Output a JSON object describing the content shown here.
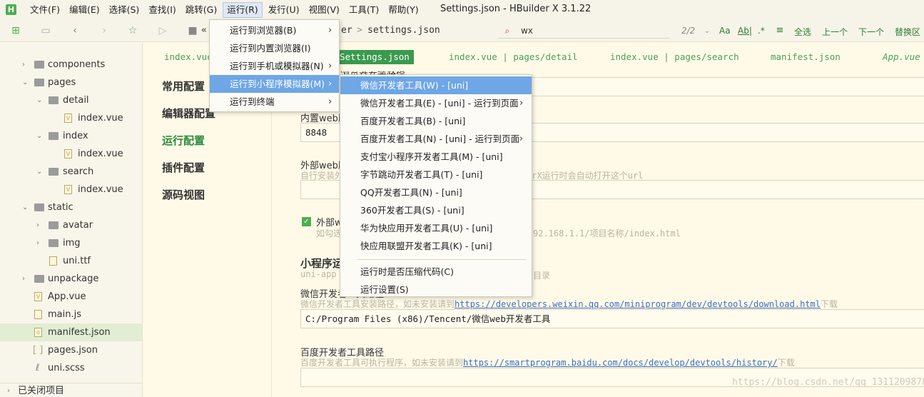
{
  "window": {
    "title": "Settings.json - HBuilder X 3.1.22",
    "logo": "H"
  },
  "menubar": [
    "文件(F)",
    "编辑(E)",
    "选择(S)",
    "查找(I)",
    "跳转(G)",
    "运行(R)",
    "发行(U)",
    "视图(V)",
    "工具(T)",
    "帮助(Y)"
  ],
  "toolbar": {
    "crumb_prefix": "«",
    "crumb_part": "er",
    "crumb_sep": ">",
    "crumb_file": "settings.json",
    "find_value": "wx",
    "find_count": "2/2",
    "find_options": [
      "Aa",
      "Ab|",
      ".*"
    ],
    "find_all": "全选",
    "find_prev": "上一个",
    "find_next": "下一个",
    "replace": "替换区"
  },
  "sidebar": {
    "items": [
      {
        "label": "components",
        "type": "folder",
        "depth": 0,
        "expanded": false
      },
      {
        "label": "pages",
        "type": "folder",
        "depth": 0,
        "expanded": true
      },
      {
        "label": "detail",
        "type": "folder",
        "depth": 1,
        "expanded": true
      },
      {
        "label": "index.vue",
        "type": "vue",
        "depth": 2
      },
      {
        "label": "index",
        "type": "folder",
        "depth": 1,
        "expanded": true
      },
      {
        "label": "index.vue",
        "type": "vue",
        "depth": 2
      },
      {
        "label": "search",
        "type": "folder",
        "depth": 1,
        "expanded": true
      },
      {
        "label": "index.vue",
        "type": "vue",
        "depth": 2
      },
      {
        "label": "static",
        "type": "folder",
        "depth": 0,
        "expanded": true
      },
      {
        "label": "avatar",
        "type": "folder",
        "depth": 1,
        "expanded": false
      },
      {
        "label": "img",
        "type": "folder",
        "depth": 1,
        "expanded": false
      },
      {
        "label": "uni.ttf",
        "type": "file",
        "depth": 1
      },
      {
        "label": "unpackage",
        "type": "folder",
        "depth": 0,
        "expanded": false
      },
      {
        "label": "App.vue",
        "type": "vue",
        "depth": 0
      },
      {
        "label": "main.js",
        "type": "file",
        "depth": 0
      },
      {
        "label": "manifest.json",
        "type": "json",
        "depth": 0,
        "selected": true
      },
      {
        "label": "pages.json",
        "type": "json",
        "depth": 0
      },
      {
        "label": "uni.scss",
        "type": "file",
        "depth": 0
      }
    ],
    "footer": "已关闭项目"
  },
  "tabs": [
    {
      "label": "index.vue"
    },
    {
      "label": "Settings.json",
      "active": true
    },
    {
      "label": "index.vue | pages/detail"
    },
    {
      "label": "index.vue | pages/search"
    },
    {
      "label": "manifest.json"
    },
    {
      "label": "App.vue"
    }
  ],
  "settings_nav": [
    {
      "label": "常用配置"
    },
    {
      "label": "编辑器配置"
    },
    {
      "label": "运行配置",
      "active": true
    },
    {
      "label": "插件配置"
    },
    {
      "label": "源码视图"
    }
  ],
  "content": {
    "top_partial_label": "浏览器安装路径",
    "builtin_port_label": "内置web服务器端口",
    "builtin_port_value": "8848",
    "external_label": "外部web服务器",
    "external_hint_start": "自行安装外部web服务器",
    "external_hint_end": "erX运行时会自动打开这个url",
    "external_checkbox_label": "外部web",
    "external_checkbox_hint_start": "如勾选",
    "external_checkbox_hint_end": "92.168.1.1/项目名称/index.html",
    "mp_section_title": "小程序运行配置",
    "mp_section_hint_start": "uni-app",
    "mp_section_hint_end": "目录",
    "wx_label": "微信开发者工具路径",
    "wx_hint_text": "微信开发者工具安装路径，如未安装请到",
    "wx_hint_link": "https://developers.weixin.qq.com/miniprogram/dev/devtools/download.html",
    "wx_hint_suffix": "下载",
    "wx_value": "C:/Program Files (x86)/Tencent/微信web开发者工具",
    "baidu_label": "百度开发者工具路径",
    "baidu_hint_text": "百度开发者工具可执行程序，如未安装请到",
    "baidu_hint_link": "https://smartprogram.baidu.com/docs/develop/devtools/history/",
    "baidu_hint_suffix": "下载"
  },
  "run_menu": [
    {
      "label": "运行到浏览器(B)",
      "submenu": true
    },
    {
      "label": "运行到内置浏览器(I)"
    },
    {
      "label": "运行到手机或模拟器(N)",
      "submenu": true
    },
    {
      "label": "运行到小程序模拟器(M)",
      "submenu": true,
      "highlighted": true
    },
    {
      "label": "运行到终端",
      "submenu": true
    }
  ],
  "mp_menu": [
    {
      "label": "微信开发者工具(W) - [uni]",
      "highlighted": true
    },
    {
      "label": "微信开发者工具(E) - [uni] - 运行到页面",
      "submenu": true
    },
    {
      "label": "百度开发者工具(B) - [uni]"
    },
    {
      "label": "百度开发者工具(N) - [uni] - 运行到页面",
      "submenu": true
    },
    {
      "label": "支付宝小程序开发者工具(M) - [uni]"
    },
    {
      "label": "字节跳动开发者工具(T) - [uni]"
    },
    {
      "label": "QQ开发者工具(N) - [uni]"
    },
    {
      "label": "360开发者工具(S) - [uni]"
    },
    {
      "label": "华为快应用开发者工具(U) - [uni]"
    },
    {
      "label": "快应用联盟开发者工具(K) - [uni]"
    },
    {
      "separator": true
    },
    {
      "label": "运行时是否压缩代码(C)"
    },
    {
      "label": "运行设置(S)"
    }
  ],
  "watermark": "https://blog.csdn.net/qq_1311209878",
  "colors": {
    "accent": "#3a9a4d",
    "menu_highlight": "#6ea6e6",
    "link": "#3b6fc4",
    "background": "#fffae8"
  }
}
